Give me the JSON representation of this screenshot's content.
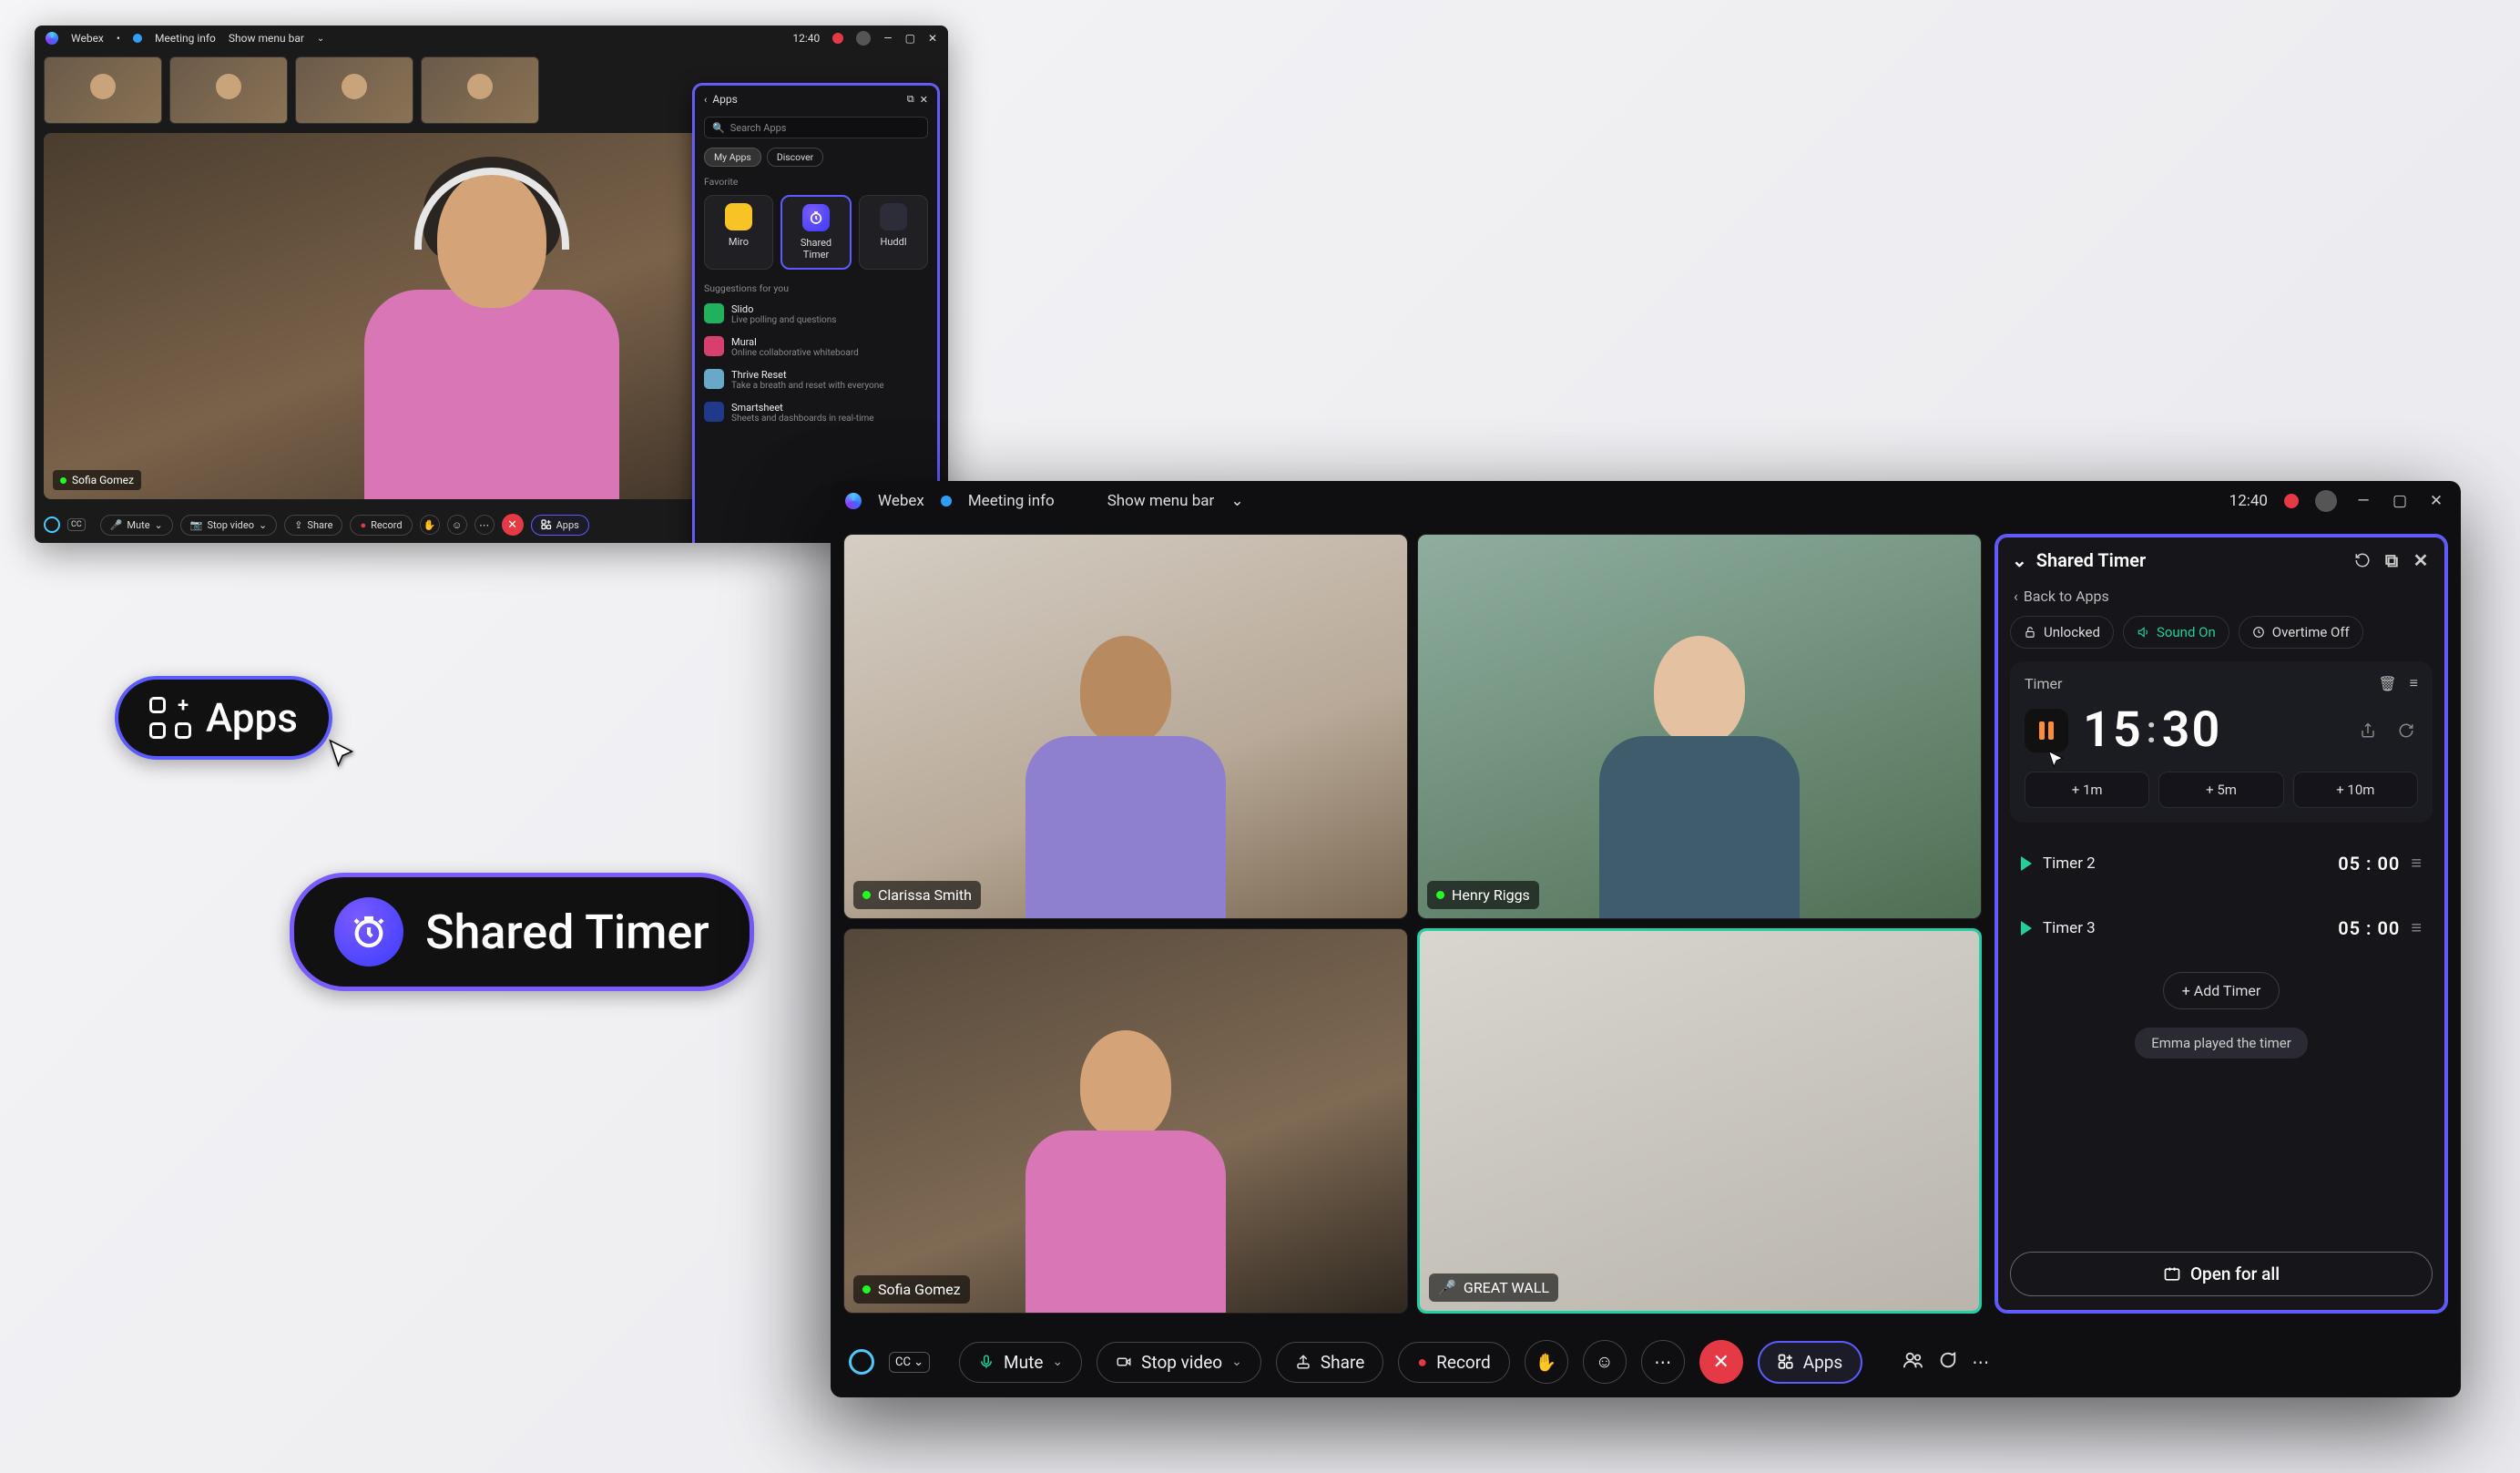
{
  "small_window": {
    "titlebar": {
      "app": "Webex",
      "meeting_info": "Meeting info",
      "show_menu": "Show menu bar",
      "time": "12:40"
    },
    "main_speaker": "Sofia Gomez",
    "apps_panel": {
      "title": "Apps",
      "search_placeholder": "Search Apps",
      "tabs": {
        "my_apps": "My Apps",
        "discover": "Discover"
      },
      "favorite_label": "Favorite",
      "favorites": [
        {
          "name": "Miro",
          "color": "#f7c325"
        },
        {
          "name": "Shared Timer",
          "color": "#6a5bff"
        },
        {
          "name": "Huddl",
          "color": "#2d2d3a"
        }
      ],
      "suggestions_label": "Suggestions for you",
      "suggestions": [
        {
          "name": "Slido",
          "desc": "Live polling and questions",
          "color": "#1fb25a"
        },
        {
          "name": "Mural",
          "desc": "Online collaborative whiteboard",
          "color": "#d63f6e"
        },
        {
          "name": "Thrive Reset",
          "desc": "Take a breath and reset with everyone",
          "color": "#6aa8c7"
        },
        {
          "name": "Smartsheet",
          "desc": "Sheets and dashboards in real-time",
          "color": "#1f3a8a"
        }
      ]
    },
    "bottombar": {
      "mute": "Mute",
      "stop_video": "Stop video",
      "share": "Share",
      "record": "Record",
      "apps": "Apps"
    }
  },
  "callouts": {
    "apps": "Apps",
    "shared_timer": "Shared Timer"
  },
  "big_window": {
    "titlebar": {
      "app": "Webex",
      "meeting_info": "Meeting info",
      "show_menu": "Show menu bar",
      "time": "12:40"
    },
    "participants": [
      {
        "name": "Clarissa Smith"
      },
      {
        "name": "Henry Riggs"
      },
      {
        "name": "Sofia Gomez"
      },
      {
        "name": "GREAT WALL"
      }
    ],
    "panel": {
      "title": "Shared Timer",
      "back": "Back to Apps",
      "toggles": {
        "unlocked": "Unlocked",
        "sound_on": "Sound On",
        "overtime_off": "Overtime Off"
      },
      "timer_card": {
        "label": "Timer",
        "minutes": "15",
        "seconds": "30",
        "add_1m": "1m",
        "add_5m": "5m",
        "add_10m": "10m"
      },
      "timers": [
        {
          "name": "Timer 2",
          "value": "05 : 00"
        },
        {
          "name": "Timer 3",
          "value": "05 : 00"
        }
      ],
      "add_timer": "Add Timer",
      "toast": "Emma played the timer",
      "open_for_all": "Open for all"
    },
    "bottombar": {
      "mute": "Mute",
      "stop_video": "Stop video",
      "share": "Share",
      "record": "Record",
      "apps": "Apps"
    }
  }
}
